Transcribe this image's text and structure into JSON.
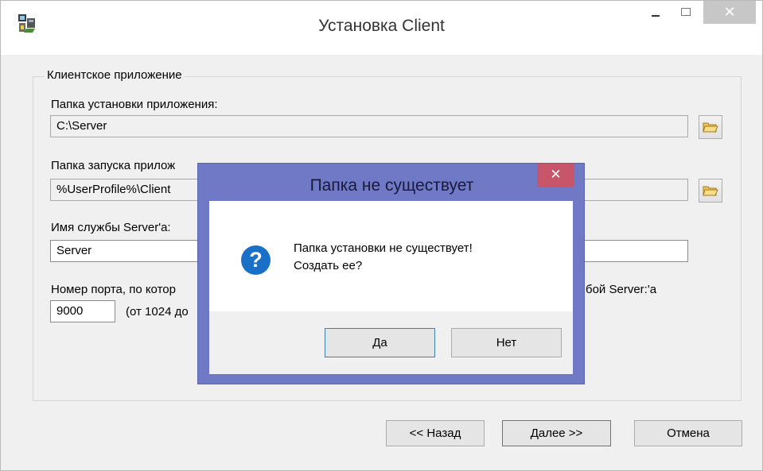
{
  "window": {
    "title": "Установка Client",
    "close_glyph": "✕",
    "icon": "installer-app-icon"
  },
  "group": {
    "label": "Клиентское приложение"
  },
  "install_folder": {
    "label": "Папка установки приложения:",
    "value": "C:\\Server"
  },
  "launch_folder": {
    "label_visible": "Папка запуска прилож",
    "value": "%UserProfile%\\Client"
  },
  "service_name": {
    "label": "Имя службы Server'a:",
    "value": "Server"
  },
  "port": {
    "label_left_visible": "Номер порта, по котор",
    "label_right_visible": "бой Server:'a",
    "value": "9000",
    "hint_visible": "(от 1024 до"
  },
  "buttons": {
    "back": "<< Назад",
    "next": "Далее >>",
    "cancel": "Отмена"
  },
  "dialog": {
    "title": "Папка не существует",
    "close_glyph": "✕",
    "icon": "question-icon",
    "icon_glyph": "?",
    "message_line1": "Папка установки не существует!",
    "message_line2": "Создать ее?",
    "yes": "Да",
    "no": "Нет"
  },
  "colors": {
    "dialog_frame": "#6f79c6",
    "dialog_close": "#c8566b",
    "question_icon": "#1a6fc7",
    "default_button_border": "#3c7fb1"
  }
}
